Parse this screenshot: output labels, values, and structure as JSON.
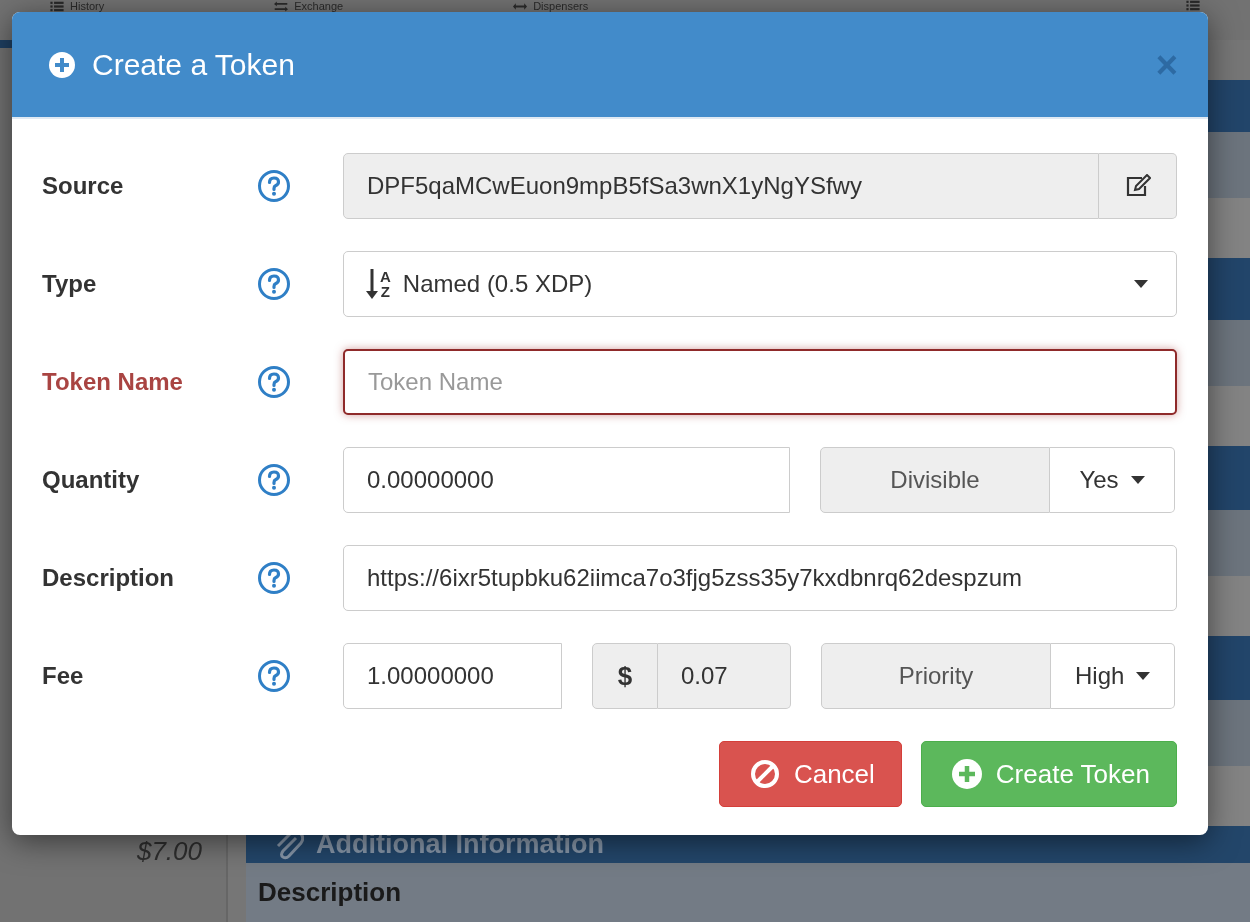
{
  "background": {
    "nav": [
      {
        "label": "History"
      },
      {
        "label": "Exchange"
      },
      {
        "label": "Dispensers"
      }
    ],
    "price": "$7.00",
    "panel_title": "Additional Information",
    "section_label": "Description"
  },
  "modal": {
    "title": "Create a Token",
    "close": "×",
    "fields": [
      {
        "kind": "addon",
        "label": "Source",
        "value": "DPF5qaMCwEuon9mpB5fSa3wnX1yNgYSfwy",
        "error": false
      },
      {
        "kind": "select",
        "label": "Type",
        "value": "Named (0.5 XDP)",
        "icon_letters": [
          "A",
          "Z"
        ],
        "error": false
      },
      {
        "kind": "text",
        "label": "Token Name",
        "placeholder": "Token Name",
        "error": true
      },
      {
        "kind": "amount",
        "label": "Quantity",
        "value": "0.00000000",
        "option_label": "Divisible",
        "option_value": "Yes",
        "error": false
      },
      {
        "kind": "text",
        "label": "Description",
        "value": "https://6ixr5tupbku62iimca7o3fjg5zss35y7kxdbnrq62despzum",
        "error": false
      },
      {
        "kind": "fee",
        "label": "Fee",
        "value": "1.00000000",
        "currency": "$",
        "usd": "0.07",
        "option_label": "Priority",
        "option_value": "High",
        "error": false
      }
    ],
    "buttons": [
      {
        "kind": "cancel",
        "label": "Cancel"
      },
      {
        "kind": "primary",
        "label": "Create Token"
      }
    ]
  }
}
